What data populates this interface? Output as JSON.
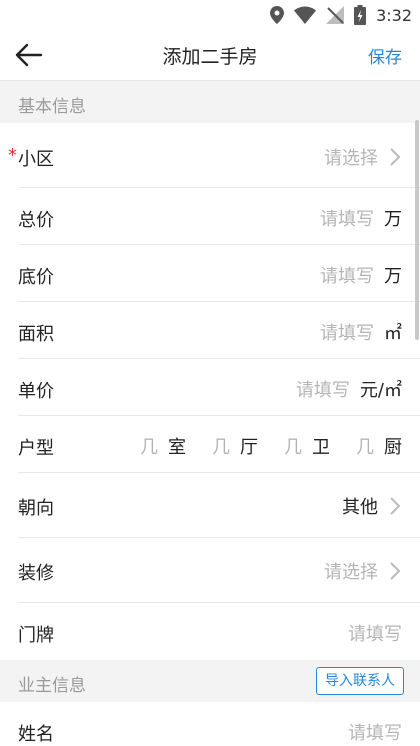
{
  "status": {
    "time": "3:32"
  },
  "appbar": {
    "title": "添加二手房",
    "save_label": "保存"
  },
  "sections": {
    "basic": "基本信息",
    "owner": "业主信息",
    "import_contacts": "导入联系人"
  },
  "required_mark": "*",
  "fields": {
    "community": {
      "label": "小区",
      "placeholder": "请选择"
    },
    "total_price": {
      "label": "总价",
      "placeholder": "请填写",
      "unit": "万"
    },
    "base_price": {
      "label": "底价",
      "placeholder": "请填写",
      "unit": "万"
    },
    "area": {
      "label": "面积",
      "placeholder": "请填写",
      "unit": "㎡"
    },
    "unit_price": {
      "label": "单价",
      "placeholder": "请填写",
      "unit": "元/㎡"
    },
    "layout": {
      "label": "户型",
      "parts": [
        {
          "placeholder": "几",
          "unit": "室"
        },
        {
          "placeholder": "几",
          "unit": "厅"
        },
        {
          "placeholder": "几",
          "unit": "卫"
        },
        {
          "placeholder": "几",
          "unit": "厨"
        }
      ]
    },
    "orientation": {
      "label": "朝向",
      "value": "其他"
    },
    "decoration": {
      "label": "装修",
      "placeholder": "请选择"
    },
    "door_plate": {
      "label": "门牌",
      "placeholder": "请填写"
    },
    "owner_name": {
      "label": "姓名",
      "placeholder": "请填写"
    }
  }
}
